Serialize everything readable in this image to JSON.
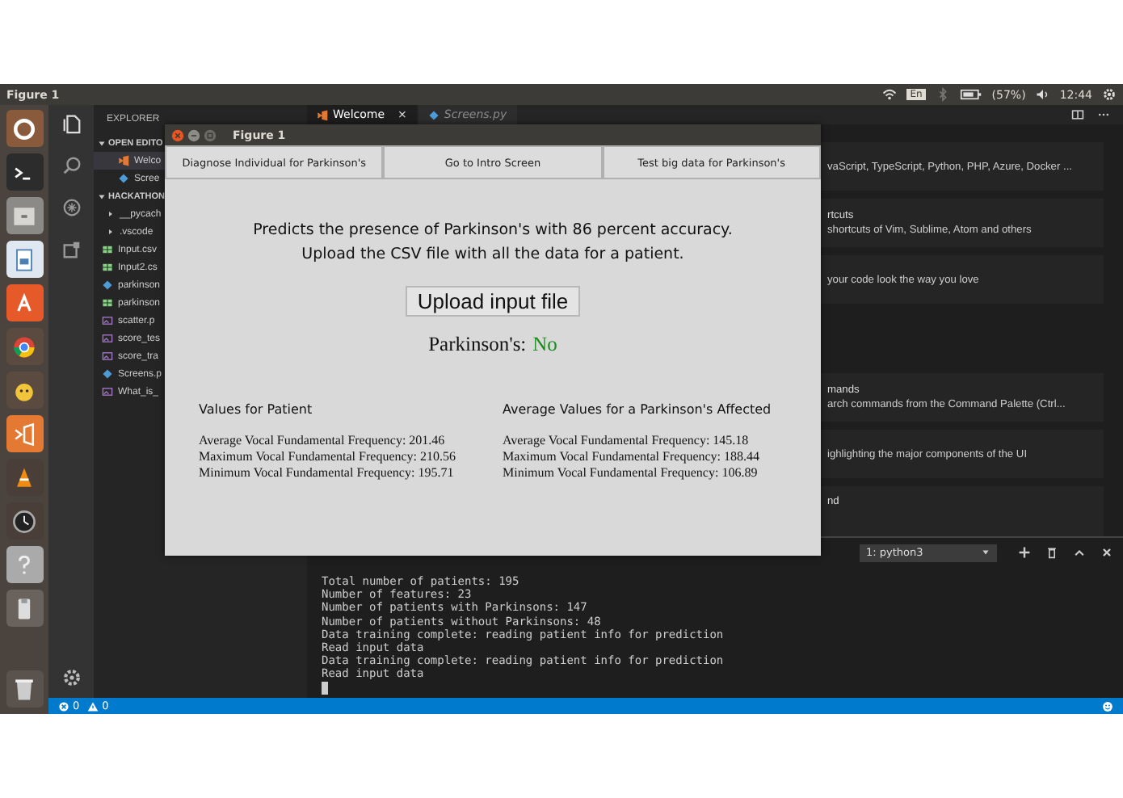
{
  "top_bar": {
    "title": "Figure 1",
    "keyboard": "En",
    "battery": "(57%)",
    "time": "12:44"
  },
  "explorer": {
    "title": "EXPLORER",
    "open_editors": {
      "label": "OPEN EDITO",
      "expanded": true,
      "items": [
        {
          "name": "Welco",
          "kind": "welcome",
          "selected": true
        },
        {
          "name": "Scree",
          "kind": "py",
          "selected": false
        }
      ]
    },
    "project": {
      "label": "HACKATHON",
      "expanded": true,
      "children": [
        {
          "name": "__pycach",
          "kind": "folder"
        },
        {
          "name": ".vscode",
          "kind": "folder"
        },
        {
          "name": "Input.csv",
          "kind": "csv"
        },
        {
          "name": "Input2.cs",
          "kind": "csv"
        },
        {
          "name": "parkinson",
          "kind": "py"
        },
        {
          "name": "parkinson",
          "kind": "csv"
        },
        {
          "name": "scatter.p",
          "kind": "image"
        },
        {
          "name": "score_tes",
          "kind": "image"
        },
        {
          "name": "score_tra",
          "kind": "image"
        },
        {
          "name": "Screens.p",
          "kind": "py"
        },
        {
          "name": "What_is_",
          "kind": "image"
        }
      ]
    }
  },
  "editor_tabs": [
    {
      "label": "Welcome",
      "kind": "welcome",
      "selected": true,
      "close": "×"
    },
    {
      "label": "Screens.py",
      "kind": "py",
      "selected": false
    }
  ],
  "welcome_cards": [
    {
      "text": "vaScript, TypeScript, Python, PHP, Azure, Docker ..."
    },
    {
      "heading": "rtcuts",
      "text": "shortcuts of Vim, Sublime, Atom and others"
    },
    {
      "text": "your code look the way you love"
    },
    {
      "heading": "mands",
      "text": "arch commands from the Command Palette (Ctrl..."
    },
    {
      "text": "ighlighting the major components of the UI"
    },
    {
      "heading": "nd"
    }
  ],
  "terminal": {
    "dropdown": "1: python3",
    "lines": [
      "Total number of patients: 195",
      "Number of features: 23",
      "Number of patients with Parkinsons: 147",
      "Number of patients without Parkinsons: 48",
      "Data training complete: reading patient info for prediction",
      "Read input data",
      "Data training complete: reading patient info for prediction",
      "Read input data"
    ]
  },
  "status_bar": {
    "errors": "0",
    "warnings": "0"
  },
  "figure": {
    "title": "Figure 1",
    "buttons": [
      "Diagnose Individual for Parkinson's",
      "Go to Intro Screen",
      "Test big data for Parkinson's"
    ],
    "intro": [
      "Predicts the presence of Parkinson's with 86 percent accuracy.",
      "Upload the CSV file with all the data for a patient."
    ],
    "upload_button": "Upload input file",
    "result": {
      "label": "Parkinson's:",
      "value": "No",
      "positive": false
    },
    "columns": [
      {
        "heading": "Values for Patient",
        "lines": [
          "Average Vocal Fundamental Frequency: 201.46",
          "Maximum Vocal Fundamental Frequency: 210.56",
          "Minimum Vocal Fundamental Frequency: 195.71"
        ]
      },
      {
        "heading": "Average Values for a Parkinson's Affected",
        "lines": [
          "Average Vocal Fundamental Frequency: 145.18",
          "Maximum Vocal Fundamental Frequency: 188.44",
          "Minimum Vocal Fundamental Frequency: 106.89"
        ]
      }
    ]
  }
}
